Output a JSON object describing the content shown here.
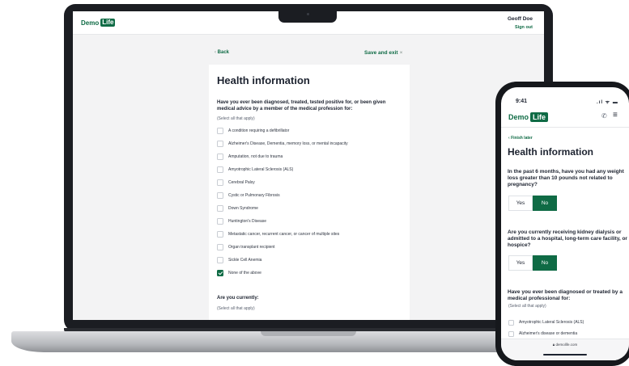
{
  "brand": {
    "name": "Demo",
    "badge": "Life",
    "color": "#0f6b45"
  },
  "laptop": {
    "user_name": "Geoff Doe",
    "sign_out": "Sign out",
    "back": "Back",
    "back_icon": "chevron-left-icon",
    "save_exit": "Save and exit",
    "close_icon": "×",
    "title": "Health information",
    "question": "Have you ever been diagnosed, treated, tested positive for, or been given medical advice by a member of the medical profession for:",
    "hint": "(Select all that apply)",
    "options": [
      {
        "label": "A condition requiring a defibrillator",
        "checked": false
      },
      {
        "label": "Alzheimer's Disease, Dementia, memory loss, or mental incapacity",
        "checked": false
      },
      {
        "label": "Amputation, not due to trauma",
        "checked": false
      },
      {
        "label": "Amyotrophic Lateral Sclerosis (ALS)",
        "checked": false
      },
      {
        "label": "Cerebral Palsy",
        "checked": false
      },
      {
        "label": "Cystic or Pulmonary Fibrosis",
        "checked": false
      },
      {
        "label": "Down Syndrome",
        "checked": false
      },
      {
        "label": "Huntington's Disease",
        "checked": false
      },
      {
        "label": "Metastatic cancer, recurrent cancer, or cancer of multiple sites",
        "checked": false
      },
      {
        "label": "Organ transplant recipient",
        "checked": false
      },
      {
        "label": "Sickle Cell Anemia",
        "checked": false
      },
      {
        "label": "None of the above",
        "checked": true
      }
    ],
    "question2": "Are you currently:",
    "hint2": "(Select all that apply)"
  },
  "phone": {
    "time": "9:41",
    "status": ".ıl ᯤ ▬",
    "phone_icon": "phone-icon",
    "menu_icon": "menu-icon",
    "finish_later": "Finish later",
    "title": "Health information",
    "questions": [
      {
        "text": "In the past 6 months, have you had any weight loss greater than 10 pounds not related to pregnancy?",
        "yes": "Yes",
        "no": "No",
        "selected": "No"
      },
      {
        "text": "Are you currently receiving kidney dialysis or admitted to a hospital, long-term care facility, or hospice?",
        "yes": "Yes",
        "no": "No",
        "selected": "No"
      }
    ],
    "question3": "Have you ever been diagnosed or treated by a medical professional for:",
    "hint": "(Select all that apply)",
    "options": [
      {
        "label": "Amyotrophic Lateral Sclerosis (ALS)",
        "checked": false
      },
      {
        "label": "Alzheimer's disease or dementia",
        "checked": false
      }
    ],
    "url": "demolife.com",
    "lock_icon": "lock-icon"
  }
}
